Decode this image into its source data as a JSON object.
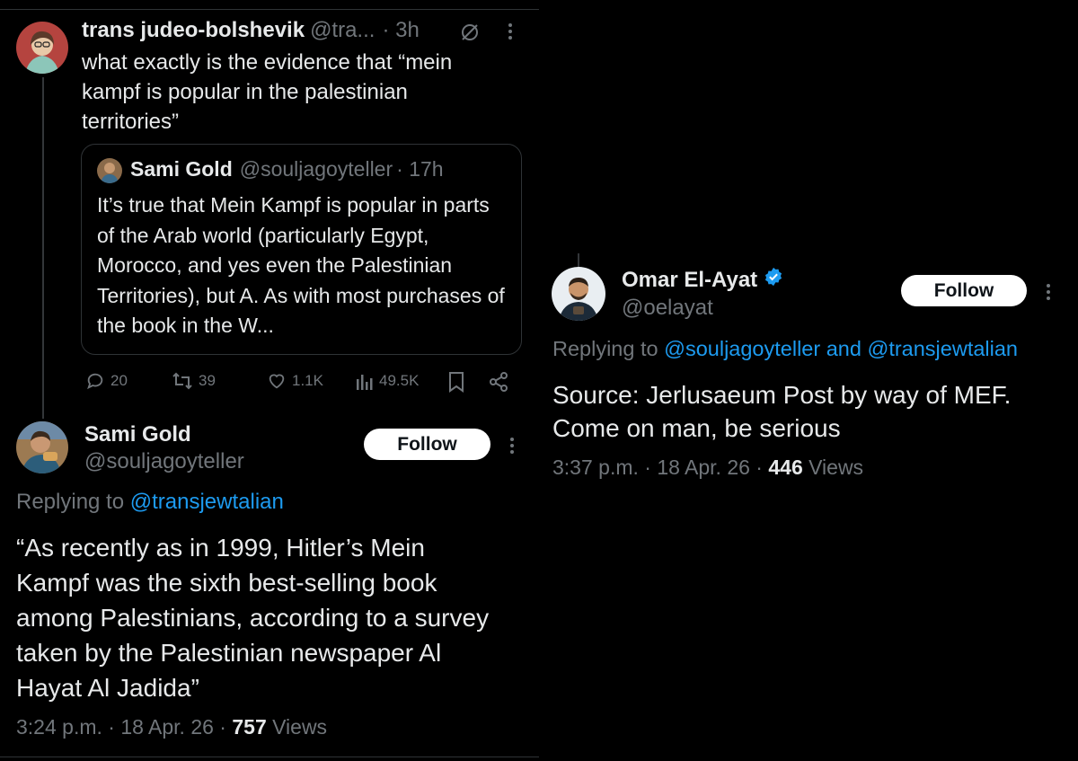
{
  "tweet1": {
    "display_name": "trans judeo-bolshevik",
    "handle": "@tra...",
    "time": "· 3h",
    "text": "what exactly is the evidence that “mein kampf is popular in the palestinian territories”",
    "quote": {
      "display_name": "Sami Gold",
      "handle": "@souljagoyteller",
      "time": "· 17h",
      "text": "It’s true that Mein Kampf is popular in parts of the Arab world (particularly Egypt, Morocco, and yes even the Palestinian Territories), but A. As with most purchases of the book in the W..."
    },
    "actions": {
      "replies": "20",
      "reposts": "39",
      "likes": "1.1K",
      "views": "49.5K"
    }
  },
  "tweet2": {
    "display_name": "Sami Gold",
    "handle": "@souljagoyteller",
    "follow_label": "Follow",
    "replying_prefix": "Replying to",
    "replying_to": "@transjewtalian",
    "text": "“As recently as in 1999, Hitler’s Mein Kampf was the sixth best-selling book among Palestinians, according to a survey taken by the Palestinian newspaper Al Hayat Al Jadida”",
    "meta_time": "3:24 p.m. · 18 Apr. 26 ·",
    "views_count": "757",
    "views_label": "Views"
  },
  "tweet3": {
    "display_name": "Omar El-Ayat",
    "handle": "@oelayat",
    "follow_label": "Follow",
    "replying_prefix": "Replying to",
    "replying_to": "@souljagoyteller and @transjewtalian",
    "text": "Source: Jerlusaeum Post by way of MEF. Come on man, be serious",
    "meta_time": "3:37 p.m. · 18 Apr. 26 ·",
    "views_count": "446",
    "views_label": "Views"
  },
  "colors": {
    "background": "#000000",
    "text": "#e7e9ea",
    "muted": "#71767b",
    "link": "#1d9bf0",
    "border": "#2f3336",
    "verified": "#1d9bf0"
  },
  "icons": [
    "more-icon",
    "mute-icon",
    "reply-icon",
    "repost-icon",
    "like-icon",
    "views-icon",
    "bookmark-icon",
    "share-icon",
    "verified-badge-icon"
  ]
}
